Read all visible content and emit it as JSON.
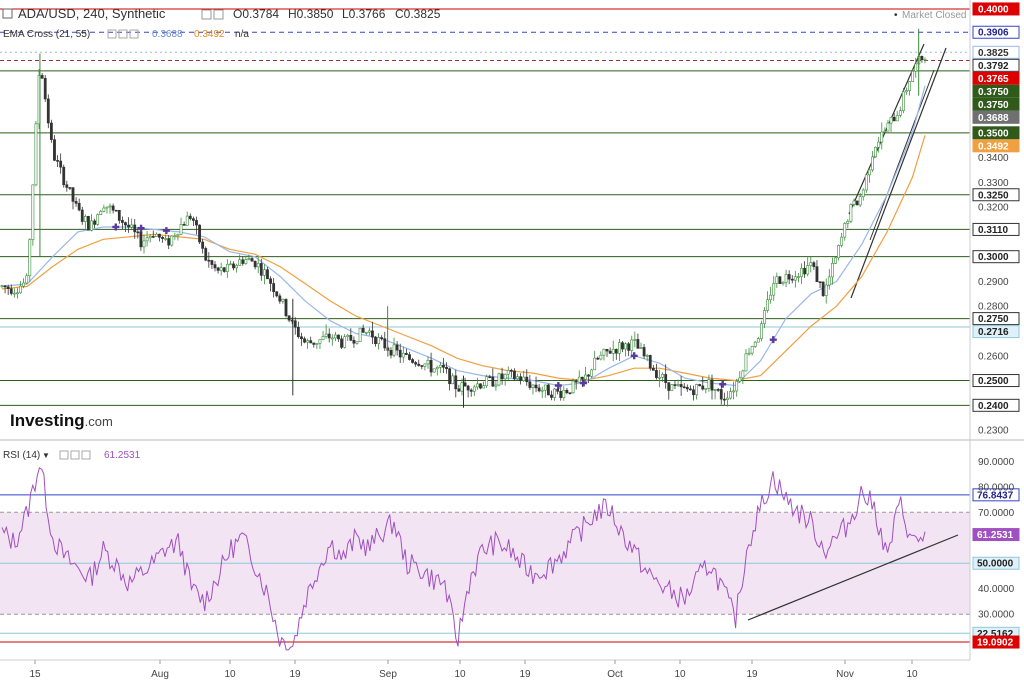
{
  "header": {
    "symbol": "ADA/USD, 240, Synthetic",
    "open": "O0.3784",
    "high": "H0.3850",
    "low": "L0.3766",
    "close": "C0.3825",
    "market_status": "Market Closed",
    "ema_label": "EMA Cross (21, 55)",
    "ema_fast_value": "0.3688",
    "ema_slow_value": "0.3492",
    "ema_extra": "n/a",
    "rsi_label": "RSI (14)",
    "rsi_value": "61.2531",
    "logo": "Investing",
    "logo_suffix": ".com"
  },
  "colors": {
    "up_candle": "#3a8c3a",
    "down_candle": "#333333",
    "ema_fast": "#9ab8e8",
    "ema_slow": "#f0a040",
    "rsi_line": "#a050c0",
    "rsi_band_fill": "#f2e4f2",
    "support_line": "#2e5e1e",
    "resistance_red": "#cc0000",
    "dashed_blue": "#3344cc",
    "marker": "#5a3aa0"
  },
  "chart_data": [
    {
      "type": "candlestick",
      "title": "ADA/USD, 240, Synthetic",
      "x_ticks": [
        "15",
        "Aug",
        "10",
        "19",
        "Sep",
        "10",
        "19",
        "Oct",
        "10",
        "19",
        "Nov",
        "10"
      ],
      "y_ticks": [
        "0.3400",
        "0.3300",
        "0.3200",
        "0.2900",
        "0.2800",
        "0.2600",
        "0.2300"
      ],
      "ylim": [
        0.226,
        0.402
      ],
      "close_path": [
        [
          0,
          0.288
        ],
        [
          1,
          0.287
        ],
        [
          2,
          0.29
        ],
        [
          3,
          0.38
        ],
        [
          4,
          0.342
        ],
        [
          5,
          0.33
        ],
        [
          6,
          0.318
        ],
        [
          7,
          0.312
        ],
        [
          8,
          0.322
        ],
        [
          9,
          0.317
        ],
        [
          10,
          0.312
        ],
        [
          11,
          0.306
        ],
        [
          12,
          0.31
        ],
        [
          13,
          0.305
        ],
        [
          14,
          0.312
        ],
        [
          15,
          0.317
        ],
        [
          16,
          0.3
        ],
        [
          17,
          0.294
        ],
        [
          18,
          0.295
        ],
        [
          19,
          0.299
        ],
        [
          20,
          0.298
        ],
        [
          21,
          0.292
        ],
        [
          22,
          0.283
        ],
        [
          23,
          0.272
        ],
        [
          24,
          0.265
        ],
        [
          25,
          0.266
        ],
        [
          26,
          0.268
        ],
        [
          27,
          0.265
        ],
        [
          28,
          0.268
        ],
        [
          29,
          0.27
        ],
        [
          30,
          0.265
        ],
        [
          31,
          0.262
        ],
        [
          32,
          0.259
        ],
        [
          33,
          0.258
        ],
        [
          34,
          0.255
        ],
        [
          35,
          0.254
        ],
        [
          36,
          0.247
        ],
        [
          37,
          0.248
        ],
        [
          38,
          0.249
        ],
        [
          39,
          0.25
        ],
        [
          40,
          0.252
        ],
        [
          41,
          0.251
        ],
        [
          42,
          0.248
        ],
        [
          43,
          0.246
        ],
        [
          44,
          0.245
        ],
        [
          45,
          0.247
        ],
        [
          46,
          0.25
        ],
        [
          47,
          0.258
        ],
        [
          48,
          0.262
        ],
        [
          49,
          0.264
        ],
        [
          50,
          0.265
        ],
        [
          51,
          0.258
        ],
        [
          52,
          0.252
        ],
        [
          53,
          0.247
        ],
        [
          54,
          0.246
        ],
        [
          55,
          0.247
        ],
        [
          56,
          0.249
        ],
        [
          57,
          0.243
        ],
        [
          58,
          0.248
        ],
        [
          59,
          0.262
        ],
        [
          60,
          0.27
        ],
        [
          61,
          0.29
        ],
        [
          62,
          0.292
        ],
        [
          63,
          0.294
        ],
        [
          64,
          0.297
        ],
        [
          65,
          0.285
        ],
        [
          66,
          0.3
        ],
        [
          67,
          0.318
        ],
        [
          68,
          0.325
        ],
        [
          69,
          0.345
        ],
        [
          70,
          0.352
        ],
        [
          71,
          0.36
        ],
        [
          72,
          0.375
        ],
        [
          73,
          0.382
        ]
      ],
      "ema_fast": [
        [
          0,
          0.288
        ],
        [
          2,
          0.289
        ],
        [
          4,
          0.3
        ],
        [
          6,
          0.31
        ],
        [
          8,
          0.312
        ],
        [
          10,
          0.312
        ],
        [
          12,
          0.311
        ],
        [
          14,
          0.31
        ],
        [
          16,
          0.308
        ],
        [
          18,
          0.302
        ],
        [
          20,
          0.3
        ],
        [
          22,
          0.292
        ],
        [
          24,
          0.282
        ],
        [
          26,
          0.274
        ],
        [
          28,
          0.269
        ],
        [
          30,
          0.267
        ],
        [
          32,
          0.263
        ],
        [
          34,
          0.259
        ],
        [
          36,
          0.254
        ],
        [
          38,
          0.252
        ],
        [
          40,
          0.251
        ],
        [
          42,
          0.25
        ],
        [
          44,
          0.248
        ],
        [
          46,
          0.249
        ],
        [
          48,
          0.255
        ],
        [
          50,
          0.26
        ],
        [
          52,
          0.257
        ],
        [
          54,
          0.251
        ],
        [
          56,
          0.249
        ],
        [
          58,
          0.248
        ],
        [
          60,
          0.258
        ],
        [
          62,
          0.275
        ],
        [
          64,
          0.285
        ],
        [
          66,
          0.29
        ],
        [
          68,
          0.305
        ],
        [
          70,
          0.325
        ],
        [
          72,
          0.35
        ],
        [
          73,
          0.369
        ]
      ],
      "ema_slow": [
        [
          0,
          0.287
        ],
        [
          2,
          0.288
        ],
        [
          4,
          0.296
        ],
        [
          6,
          0.303
        ],
        [
          8,
          0.307
        ],
        [
          10,
          0.308
        ],
        [
          12,
          0.309
        ],
        [
          14,
          0.308
        ],
        [
          16,
          0.307
        ],
        [
          18,
          0.303
        ],
        [
          20,
          0.301
        ],
        [
          22,
          0.296
        ],
        [
          24,
          0.289
        ],
        [
          26,
          0.282
        ],
        [
          28,
          0.276
        ],
        [
          30,
          0.272
        ],
        [
          32,
          0.268
        ],
        [
          34,
          0.264
        ],
        [
          36,
          0.259
        ],
        [
          38,
          0.256
        ],
        [
          40,
          0.254
        ],
        [
          42,
          0.253
        ],
        [
          44,
          0.251
        ],
        [
          46,
          0.25
        ],
        [
          48,
          0.252
        ],
        [
          50,
          0.255
        ],
        [
          52,
          0.255
        ],
        [
          54,
          0.253
        ],
        [
          56,
          0.251
        ],
        [
          58,
          0.25
        ],
        [
          60,
          0.252
        ],
        [
          62,
          0.262
        ],
        [
          64,
          0.272
        ],
        [
          66,
          0.28
        ],
        [
          68,
          0.292
        ],
        [
          70,
          0.31
        ],
        [
          72,
          0.332
        ],
        [
          73,
          0.349
        ]
      ],
      "x_max": 73,
      "horizontal_levels": [
        {
          "value": 0.4,
          "label": "0.4000",
          "style": "red",
          "badge": "red"
        },
        {
          "value": 0.3906,
          "label": "0.3906",
          "style": "dashed-blue",
          "badge": "outline-blue"
        },
        {
          "value": 0.3825,
          "label": "0.3825",
          "style": "dotted",
          "badge": "outline-light"
        },
        {
          "value": 0.3792,
          "label": "0.3792",
          "style": "dashed-red",
          "badge": "outline-dark"
        },
        {
          "value": 0.3765,
          "label": "0.3765",
          "style": "none",
          "badge": "red"
        },
        {
          "value": 0.375,
          "label": "0.3750",
          "style": "green",
          "badge": "green"
        },
        {
          "value": 0.375,
          "label": "0.3750",
          "style": "none",
          "badge": "green"
        },
        {
          "value": 0.3688,
          "label": "0.3688",
          "style": "none",
          "badge": "gray"
        },
        {
          "value": 0.35,
          "label": "0.3500",
          "style": "green",
          "badge": "green"
        },
        {
          "value": 0.3492,
          "label": "0.3492",
          "style": "none",
          "badge": "orange"
        },
        {
          "value": 0.325,
          "label": "0.3250",
          "style": "green",
          "badge": "outline-dark"
        },
        {
          "value": 0.311,
          "label": "0.3110",
          "style": "green",
          "badge": "outline-dark"
        },
        {
          "value": 0.3,
          "label": "0.3000",
          "style": "green",
          "badge": "outline-dark"
        },
        {
          "value": 0.275,
          "label": "0.2750",
          "style": "green",
          "badge": "outline-dark"
        },
        {
          "value": 0.2716,
          "label": "0.2716",
          "style": "light-blue",
          "badge": "light-blue"
        },
        {
          "value": 0.25,
          "label": "0.2500",
          "style": "green",
          "badge": "outline-dark"
        },
        {
          "value": 0.24,
          "label": "0.2400",
          "style": "green",
          "badge": "outline-dark"
        }
      ],
      "cross_markers_x": [
        9,
        11,
        13,
        44,
        46,
        50,
        57,
        61
      ]
    },
    {
      "type": "line",
      "title": "RSI (14)",
      "y_ticks": [
        "90.0000",
        "80.0000",
        "70.0000",
        "40.0000",
        "30.0000"
      ],
      "ylim": [
        14,
        96
      ],
      "band": [
        30,
        70
      ],
      "values": [
        [
          0,
          62
        ],
        [
          1,
          58
        ],
        [
          2,
          70
        ],
        [
          3,
          90
        ],
        [
          4,
          60
        ],
        [
          5,
          52
        ],
        [
          6,
          48
        ],
        [
          7,
          44
        ],
        [
          8,
          55
        ],
        [
          9,
          50
        ],
        [
          10,
          42
        ],
        [
          11,
          46
        ],
        [
          12,
          50
        ],
        [
          13,
          56
        ],
        [
          14,
          58
        ],
        [
          15,
          40
        ],
        [
          16,
          35
        ],
        [
          17,
          44
        ],
        [
          18,
          55
        ],
        [
          19,
          60
        ],
        [
          20,
          50
        ],
        [
          21,
          38
        ],
        [
          22,
          20
        ],
        [
          23,
          18
        ],
        [
          24,
          36
        ],
        [
          25,
          48
        ],
        [
          26,
          58
        ],
        [
          27,
          52
        ],
        [
          28,
          60
        ],
        [
          29,
          56
        ],
        [
          30,
          62
        ],
        [
          31,
          66
        ],
        [
          32,
          50
        ],
        [
          33,
          48
        ],
        [
          34,
          44
        ],
        [
          35,
          42
        ],
        [
          36,
          19
        ],
        [
          37,
          44
        ],
        [
          38,
          55
        ],
        [
          39,
          58
        ],
        [
          40,
          56
        ],
        [
          41,
          50
        ],
        [
          42,
          46
        ],
        [
          43,
          48
        ],
        [
          44,
          52
        ],
        [
          45,
          58
        ],
        [
          46,
          64
        ],
        [
          47,
          70
        ],
        [
          48,
          72
        ],
        [
          49,
          62
        ],
        [
          50,
          55
        ],
        [
          51,
          46
        ],
        [
          52,
          42
        ],
        [
          53,
          38
        ],
        [
          54,
          36
        ],
        [
          55,
          44
        ],
        [
          56,
          50
        ],
        [
          57,
          40
        ],
        [
          58,
          28
        ],
        [
          59,
          58
        ],
        [
          60,
          72
        ],
        [
          61,
          84
        ],
        [
          62,
          75
        ],
        [
          63,
          70
        ],
        [
          64,
          66
        ],
        [
          65,
          55
        ],
        [
          66,
          60
        ],
        [
          67,
          66
        ],
        [
          68,
          78
        ],
        [
          69,
          72
        ],
        [
          70,
          52
        ],
        [
          71,
          74
        ],
        [
          72,
          58
        ],
        [
          73,
          61
        ]
      ],
      "horizontal_levels": [
        {
          "value": 76.8437,
          "label": "76.8437",
          "style": "blue",
          "badge": "outline-blue"
        },
        {
          "value": 61.2531,
          "label": "61.2531",
          "style": "none",
          "badge": "purple"
        },
        {
          "value": 50.0,
          "label": "50.0000",
          "style": "light-blue",
          "badge": "light-blue"
        },
        {
          "value": 22.5162,
          "label": "22.5162",
          "style": "light-blue",
          "badge": "light-blue"
        },
        {
          "value": 19.0902,
          "label": "19.0902",
          "style": "red",
          "badge": "red"
        }
      ]
    }
  ]
}
